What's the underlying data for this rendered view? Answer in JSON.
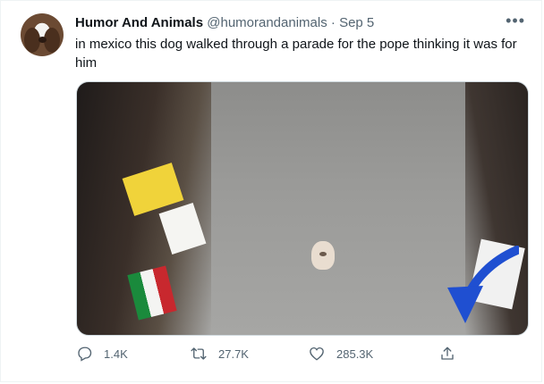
{
  "tweet": {
    "author_name": "Humor And Animals",
    "handle": "@humorandanimals",
    "separator": "·",
    "date": "Sep 5",
    "more_label": "•••",
    "text": "in mexico this dog walked through a parade for the pope thinking it was for him"
  },
  "media": {
    "icon": "annotation-arrow-icon",
    "arrow_color": "#1f4fd1"
  },
  "actions": {
    "replies": "1.4K",
    "retweets": "27.7K",
    "likes": "285.3K",
    "share_icon": "share-icon"
  }
}
